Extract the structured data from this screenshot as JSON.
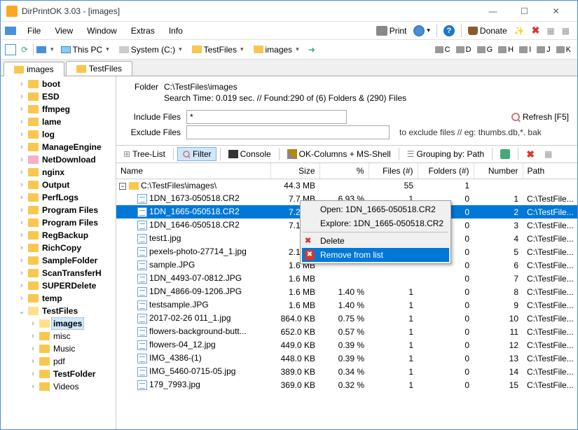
{
  "window": {
    "title": "DirPrintOK 3.03 - [images]",
    "min": "—",
    "max": "☐",
    "close": "✕"
  },
  "menu": {
    "file": "File",
    "view": "View",
    "window": "Window",
    "extras": "Extras",
    "info": "Info",
    "print": "Print",
    "donate": "Donate"
  },
  "loc": {
    "this_pc": "This PC",
    "system": "System (C:)",
    "testfiles": "TestFiles",
    "images": "images",
    "drives": [
      "C",
      "D",
      "G",
      "H",
      "I",
      "J",
      "K"
    ]
  },
  "tabs": {
    "t1": "images",
    "t2": "TestFiles"
  },
  "tree": [
    {
      "label": "boot",
      "bold": true,
      "indent": 24,
      "toggle": "›"
    },
    {
      "label": "ESD",
      "bold": true,
      "indent": 24,
      "toggle": "›"
    },
    {
      "label": "ffmpeg",
      "bold": true,
      "indent": 24,
      "toggle": "›"
    },
    {
      "label": "lame",
      "bold": true,
      "indent": 24,
      "toggle": "›"
    },
    {
      "label": "log",
      "bold": true,
      "indent": 24,
      "toggle": "›"
    },
    {
      "label": "ManageEngine",
      "bold": true,
      "indent": 24,
      "toggle": "›"
    },
    {
      "label": "NetDownload",
      "bold": true,
      "indent": 24,
      "toggle": "›",
      "pink": true
    },
    {
      "label": "nginx",
      "bold": true,
      "indent": 24,
      "toggle": "›"
    },
    {
      "label": "Output",
      "bold": true,
      "indent": 24,
      "toggle": "›"
    },
    {
      "label": "PerfLogs",
      "bold": true,
      "indent": 24,
      "toggle": "›"
    },
    {
      "label": "Program Files",
      "bold": true,
      "indent": 24,
      "toggle": "›"
    },
    {
      "label": "Program Files",
      "bold": true,
      "indent": 24,
      "toggle": "›"
    },
    {
      "label": "RegBackup",
      "bold": true,
      "indent": 24,
      "toggle": "›"
    },
    {
      "label": "RichCopy",
      "bold": true,
      "indent": 24,
      "toggle": "›"
    },
    {
      "label": "SampleFolder",
      "bold": true,
      "indent": 24,
      "toggle": "›"
    },
    {
      "label": "ScanTransferH",
      "bold": true,
      "indent": 24,
      "toggle": "›"
    },
    {
      "label": "SUPERDelete",
      "bold": true,
      "indent": 24,
      "toggle": "›"
    },
    {
      "label": "temp",
      "bold": true,
      "indent": 24,
      "toggle": "›"
    },
    {
      "label": "TestFiles",
      "bold": true,
      "indent": 24,
      "toggle": "⌄",
      "open": true
    },
    {
      "label": "images",
      "bold": true,
      "indent": 40,
      "toggle": "›",
      "selected": true,
      "open": true
    },
    {
      "label": "misc",
      "bold": false,
      "indent": 40,
      "toggle": "›"
    },
    {
      "label": "Music",
      "bold": false,
      "indent": 40,
      "toggle": "›"
    },
    {
      "label": "pdf",
      "bold": false,
      "indent": 40,
      "toggle": "›"
    },
    {
      "label": "TestFolder",
      "bold": true,
      "indent": 40,
      "toggle": "›"
    },
    {
      "label": "Videos",
      "bold": false,
      "indent": 40,
      "toggle": "›"
    }
  ],
  "info": {
    "folder_lbl": "Folder",
    "folder_path": "C:\\TestFiles\\images",
    "search_stats": "Search Time: 0.019 sec. //   Found:290 of (6) Folders & (290) Files",
    "include_lbl": "Include Files",
    "include_val": "*",
    "exclude_lbl": "Exclude Files",
    "exclude_hint": "to exclude files // eg: thumbs.db,*. bak",
    "refresh": "Refresh [F5]"
  },
  "toolbar2": {
    "treelist": "Tree-List",
    "filter": "Filter",
    "console": "Console",
    "okcols": "OK-Columns + MS-Shell",
    "grouping": "Grouping by: Path"
  },
  "columns": {
    "name": "Name",
    "size": "Size",
    "pct": "%",
    "files": "Files (#)",
    "folders": "Folders (#)",
    "number": "Number",
    "path": "Path"
  },
  "group_row": {
    "name": "C:\\TestFiles\\images\\",
    "size": "44.3 MB",
    "pct": "",
    "files": "55",
    "folders": "1",
    "number": "",
    "path": ""
  },
  "rows": [
    {
      "name": "1DN_1673-050518.CR2",
      "size": "7.7 MB",
      "pct": "6.93 %",
      "files": "1",
      "folders": "0",
      "number": "1",
      "path": "C:\\TestFile..."
    },
    {
      "name": "1DN_1665-050518.CR2",
      "size": "7.2 MB",
      "pct": "",
      "files": "",
      "folders": "0",
      "number": "2",
      "path": "C:\\TestFile...",
      "selected": true
    },
    {
      "name": "1DN_1646-050518.CR2",
      "size": "7.1 MB",
      "pct": "",
      "files": "",
      "folders": "0",
      "number": "3",
      "path": "C:\\TestFile..."
    },
    {
      "name": "test1.jpg",
      "size": "",
      "pct": "",
      "files": "",
      "folders": "0",
      "number": "4",
      "path": "C:\\TestFile..."
    },
    {
      "name": "pexels-photo-27714_1.jpg",
      "size": "2.1 MB",
      "pct": "",
      "files": "",
      "folders": "0",
      "number": "5",
      "path": "C:\\TestFile..."
    },
    {
      "name": "sample.JPG",
      "size": "1.6 MB",
      "pct": "",
      "files": "",
      "folders": "0",
      "number": "6",
      "path": "C:\\TestFile..."
    },
    {
      "name": "1DN_4493-07-0812.JPG",
      "size": "1.6 MB",
      "pct": "",
      "files": "",
      "folders": "0",
      "number": "7",
      "path": "C:\\TestFile..."
    },
    {
      "name": "1DN_4866-09-1206.JPG",
      "size": "1.6 MB",
      "pct": "1.40 %",
      "files": "1",
      "folders": "0",
      "number": "8",
      "path": "C:\\TestFile..."
    },
    {
      "name": "testsample.JPG",
      "size": "1.6 MB",
      "pct": "1.40 %",
      "files": "1",
      "folders": "0",
      "number": "9",
      "path": "C:\\TestFile..."
    },
    {
      "name": "2017-02-26 011_1.jpg",
      "size": "864.0 KB",
      "pct": "0.75 %",
      "files": "1",
      "folders": "0",
      "number": "10",
      "path": "C:\\TestFile..."
    },
    {
      "name": "flowers-background-butt...",
      "size": "652.0 KB",
      "pct": "0.57 %",
      "files": "1",
      "folders": "0",
      "number": "11",
      "path": "C:\\TestFile..."
    },
    {
      "name": "flowers-04_12.jpg",
      "size": "449.0 KB",
      "pct": "0.39 %",
      "files": "1",
      "folders": "0",
      "number": "12",
      "path": "C:\\TestFile..."
    },
    {
      "name": "IMG_4386-(1)",
      "size": "448.0 KB",
      "pct": "0.39 %",
      "files": "1",
      "folders": "0",
      "number": "13",
      "path": "C:\\TestFile..."
    },
    {
      "name": "IMG_5460-0715-05.jpg",
      "size": "389.0 KB",
      "pct": "0.34 %",
      "files": "1",
      "folders": "0",
      "number": "14",
      "path": "C:\\TestFile..."
    },
    {
      "name": "179_7993.jpg",
      "size": "369.0 KB",
      "pct": "0.32 %",
      "files": "1",
      "folders": "0",
      "number": "15",
      "path": "C:\\TestFile..."
    }
  ],
  "ctx": {
    "open": "Open: 1DN_1665-050518.CR2",
    "explore": "Explore: 1DN_1665-050518.CR2",
    "delete": "Delete",
    "remove": "Remove from list"
  }
}
